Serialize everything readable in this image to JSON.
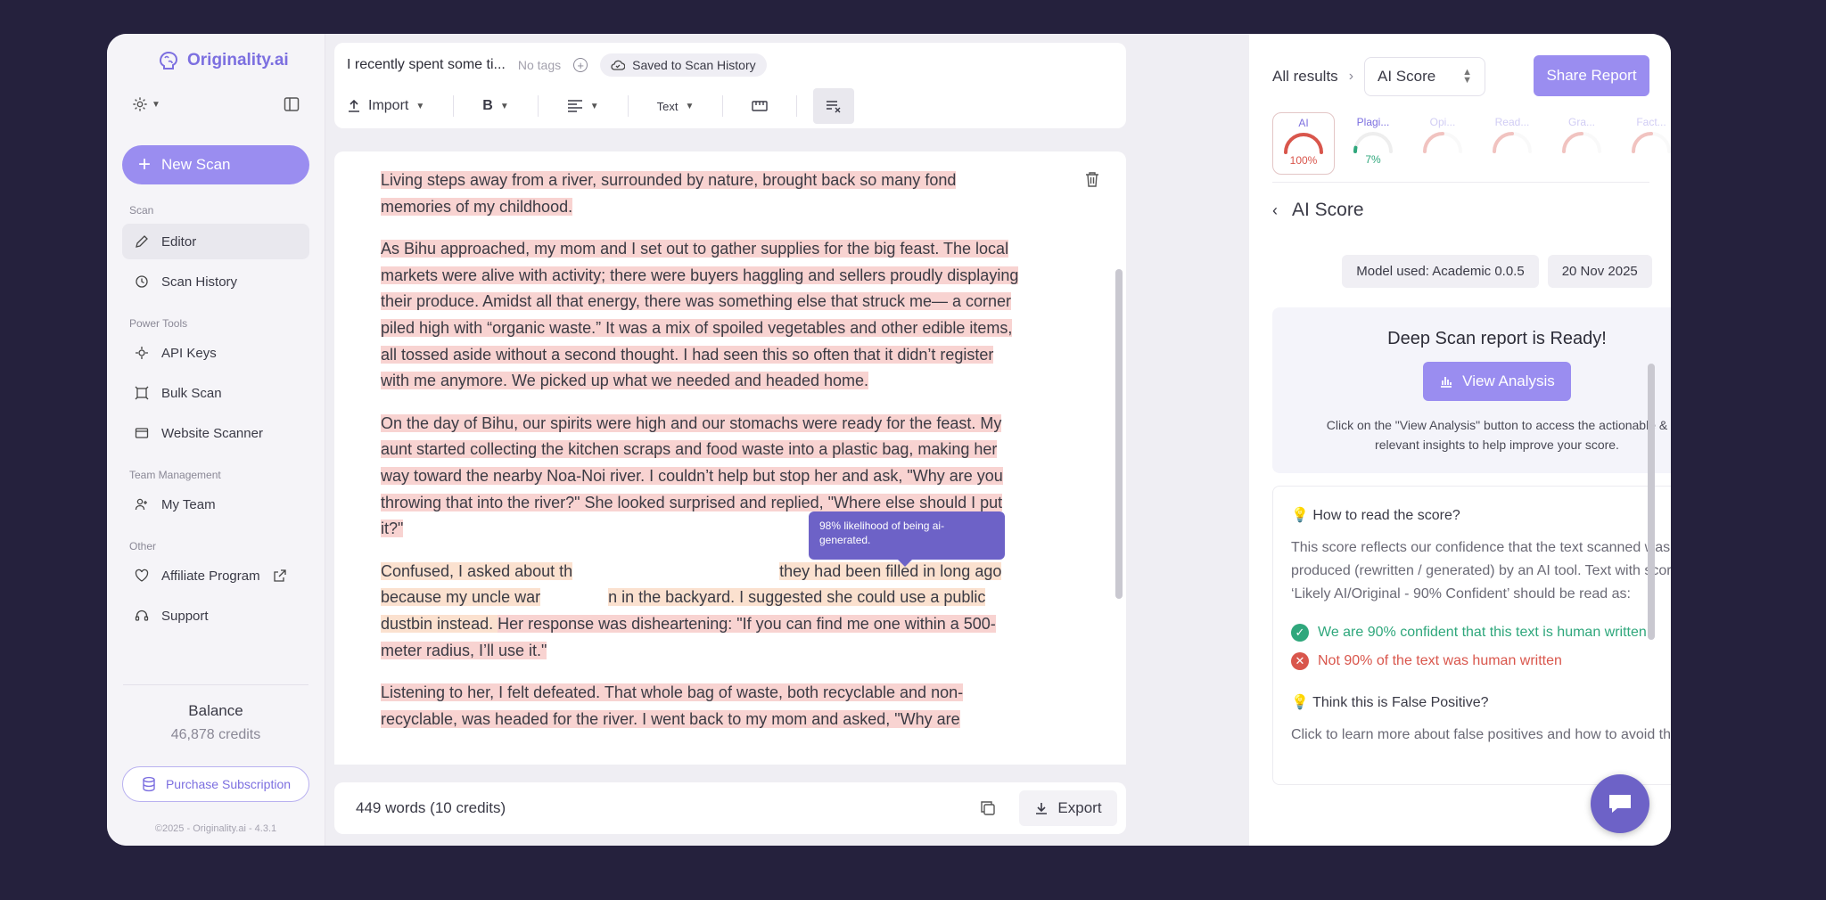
{
  "app": {
    "logo_text": "Originality.ai",
    "new_scan_label": "New Scan",
    "sections": {
      "scan": "Scan",
      "power_tools": "Power Tools",
      "team": "Team Management",
      "other": "Other"
    },
    "nav": {
      "editor": "Editor",
      "scan_history": "Scan History",
      "api_keys": "API Keys",
      "bulk_scan": "Bulk Scan",
      "website_scanner": "Website Scanner",
      "my_team": "My Team",
      "affiliate": "Affiliate Program",
      "support": "Support"
    },
    "balance_title": "Balance",
    "balance_credits": "46,878 credits",
    "purchase_label": "Purchase Subscription",
    "copyright": "©2025 - Originality.ai - 4.3.1",
    "accent_color": "#9a8df0"
  },
  "editor": {
    "doc_title": "I recently spent some ti...",
    "no_tags": "No tags",
    "saved_label": "Saved to Scan History",
    "import_label": "Import",
    "bold_label": "B",
    "text_style_label": "Text",
    "tooltip_text": "98% likelihood of being ai-generated.",
    "paragraphs": [
      "Living steps away from a river, surrounded by nature, brought back so many fond memories of my childhood.",
      "As Bihu approached, my mom and I set out to gather supplies for the big feast. The local markets were alive with activity; there were buyers haggling and sellers proudly displaying their produce. Amidst all that energy, there was something else that struck me— a corner piled high with “organic waste.” It was a mix of spoiled vegetables and other edible items, all tossed aside without a second thought. I had seen this so often that it didn’t register with me anymore. We picked up what we needed and headed home.",
      "On the day of Bihu, our spirits were high and our stomachs were ready for the feast. My aunt started collecting the kitchen scraps and food waste into a plastic bag, making her way toward the nearby Noa-Noi river. I couldn’t help but stop her and ask, \"Why are you throwing that into the river?\" She looked surprised and replied, \"Where else should I put it?\"",
      "Listening to her, I felt defeated. That whole bag of waste, both recyclable and non-recyclable, was headed for the river. I went back to my mom and asked, \"Why are"
    ],
    "para4": {
      "seg_a": "Confused, I asked about th",
      "seg_b": "they had been filled in long ago because my uncle war",
      "seg_c": "n in the backyard. I suggested she could use a public dustbin instead. ",
      "seg_d": "Her response was disheartening: \"If you can find me one within a 500-meter radius, I’ll use it.\""
    },
    "word_count": "449 words (10 credits)",
    "export_label": "Export"
  },
  "panel": {
    "breadcrumb": "All results",
    "select_value": "AI Score",
    "share_label": "Share Report",
    "gauges": [
      {
        "label": "AI",
        "value": "100%",
        "color": "#d9564c",
        "fill": 1.0
      },
      {
        "label": "Plagi...",
        "value": "7%",
        "color": "#2fa77c",
        "fill": 0.07
      },
      {
        "label": "Opi...",
        "value": "",
        "color": "#d9564c",
        "fill": 0.5
      },
      {
        "label": "Read...",
        "value": "",
        "color": "#d9564c",
        "fill": 0.5
      },
      {
        "label": "Gra...",
        "value": "",
        "color": "#d9564c",
        "fill": 0.5
      },
      {
        "label": "Fact...",
        "value": "",
        "color": "#d9564c",
        "fill": 0.5
      }
    ],
    "section_title": "AI Score",
    "model_used": "Model used: Academic 0.0.5",
    "date": "20 Nov 2025",
    "deep_title": "Deep Scan report is Ready!",
    "view_label": "View Analysis",
    "deep_note": "Click on the \"View Analysis\" button to access the actionable & relevant insights to help improve your score.",
    "howto_title": "How to read the score?",
    "howto_desc": "This score reflects our confidence that the text scanned was produced (rewritten / generated) by an AI tool. Text with score ‘Likely AI/Original - 90% Confident’ should be read as:",
    "good_line": "We are 90% confident that this text is human written",
    "bad_line": "Not 90% of the text was human written",
    "fp_title": "Think this is False Positive?",
    "fp_desc": "Click to learn more about false positives and how to avoid them."
  }
}
